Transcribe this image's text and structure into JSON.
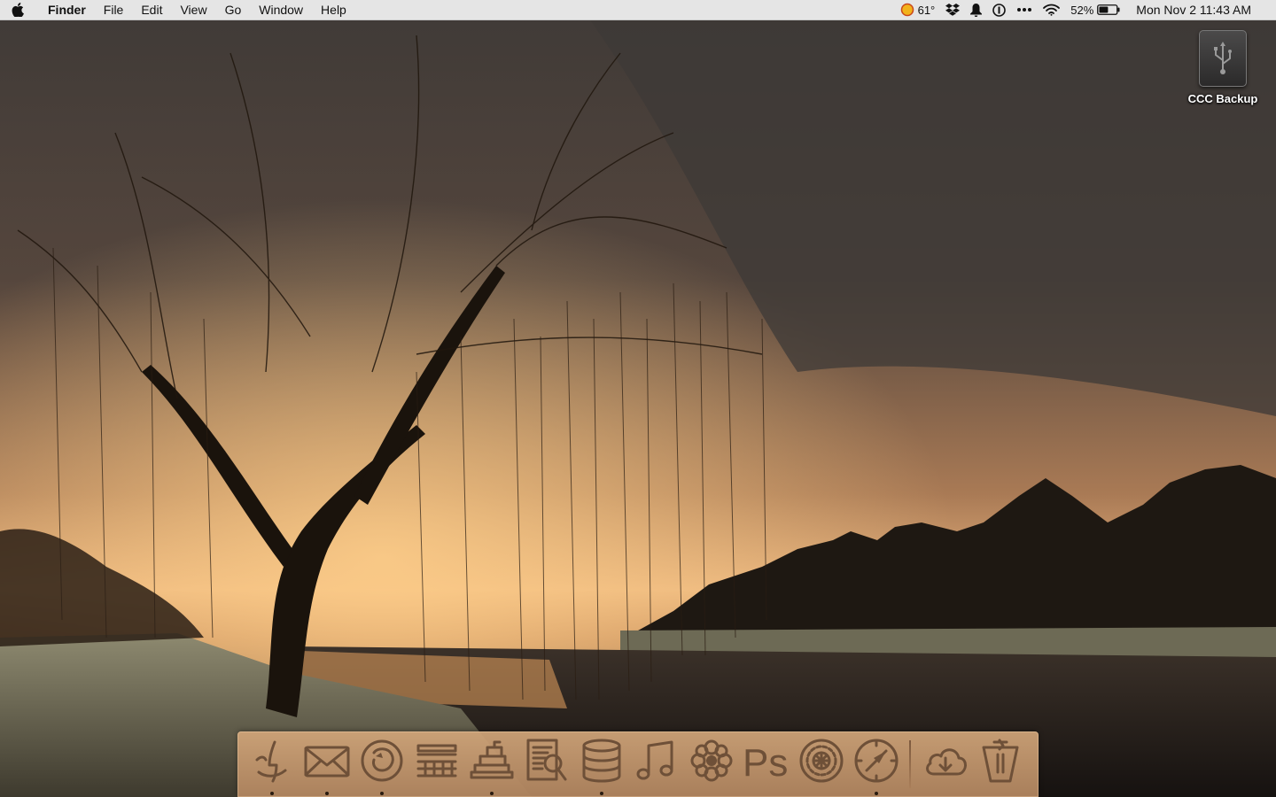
{
  "menubar": {
    "apple_icon": "apple-icon",
    "app_name": "Finder",
    "menus": [
      "File",
      "Edit",
      "View",
      "Go",
      "Window",
      "Help"
    ],
    "status": {
      "weather_temp": "61°",
      "battery_percent": "52%",
      "battery_level": 0.52,
      "clock": "Mon Nov 2  11:43 AM",
      "icons": [
        "weather-icon",
        "dropbox-icon",
        "notification-bell-icon",
        "1password-icon",
        "more-dots-icon",
        "wifi-icon",
        "battery-icon"
      ]
    }
  },
  "desktop": {
    "items": [
      {
        "label": "CCC Backup",
        "icon": "usb-drive-icon"
      }
    ]
  },
  "dock": {
    "apps": [
      {
        "icon": "finder-icon",
        "running": true
      },
      {
        "icon": "mail-icon",
        "running": true
      },
      {
        "icon": "firefox-icon",
        "running": true
      },
      {
        "icon": "coda-icon",
        "running": false
      },
      {
        "icon": "stacks-icon",
        "running": true
      },
      {
        "icon": "preview-icon",
        "running": false
      },
      {
        "icon": "database-icon",
        "running": true
      },
      {
        "icon": "music-note-icon",
        "running": false
      },
      {
        "icon": "flower-icon",
        "running": false
      },
      {
        "icon": "photoshop-icon",
        "running": false
      },
      {
        "icon": "system-preferences-icon",
        "running": false
      },
      {
        "icon": "safari-icon",
        "running": true
      }
    ],
    "photoshop_label": "Ps",
    "others": [
      {
        "icon": "downloads-cloud-icon",
        "running": false
      },
      {
        "icon": "trash-icon",
        "running": false
      }
    ]
  }
}
